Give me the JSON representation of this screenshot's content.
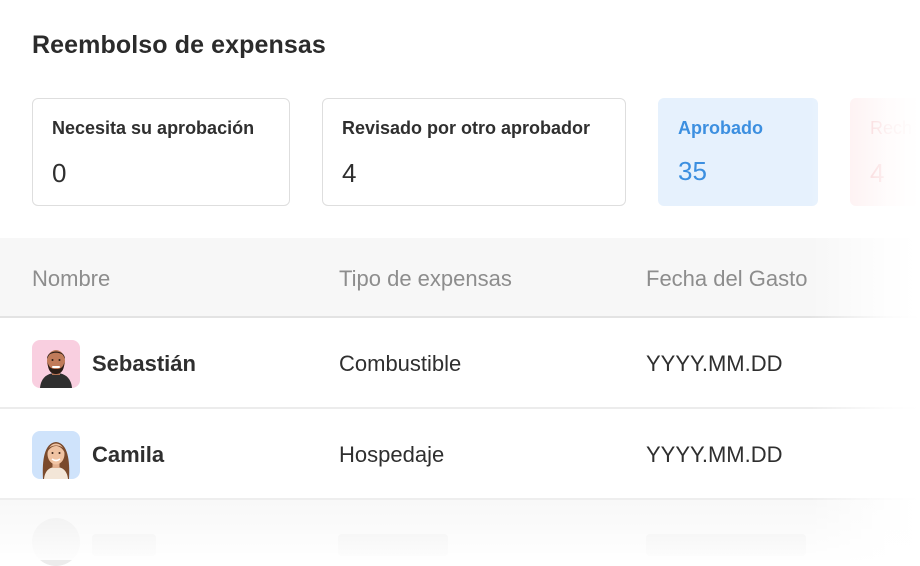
{
  "page": {
    "title": "Reembolso de expensas"
  },
  "summary": {
    "needs_approval": {
      "label": "Necesita su aprobación",
      "count": "0"
    },
    "reviewed_by_other": {
      "label": "Revisado por otro aprobador",
      "count": "4"
    },
    "approved": {
      "label": "Aprobado",
      "count": "35"
    },
    "rejected": {
      "label": "Rech",
      "count": "4"
    }
  },
  "table": {
    "columns": [
      "Nombre",
      "Tipo de expensas",
      "Fecha del Gasto"
    ],
    "rows": [
      {
        "name": "Sebastián",
        "type": "Combustible",
        "date": "YYYY.MM.DD",
        "avatar_icon": "person-male-avatar-icon"
      },
      {
        "name": "Camila",
        "type": "Hospedaje",
        "date": "YYYY.MM.DD",
        "avatar_icon": "person-female-avatar-icon"
      }
    ]
  },
  "colors": {
    "approved_bg": "#e6f1fd",
    "approved_text": "#3c8fe0",
    "rejected_bg": "#fde9ea",
    "rejected_text": "#f0a2a6",
    "avatar_pink": "#f9cfe0",
    "avatar_blue": "#cfe3fb"
  }
}
